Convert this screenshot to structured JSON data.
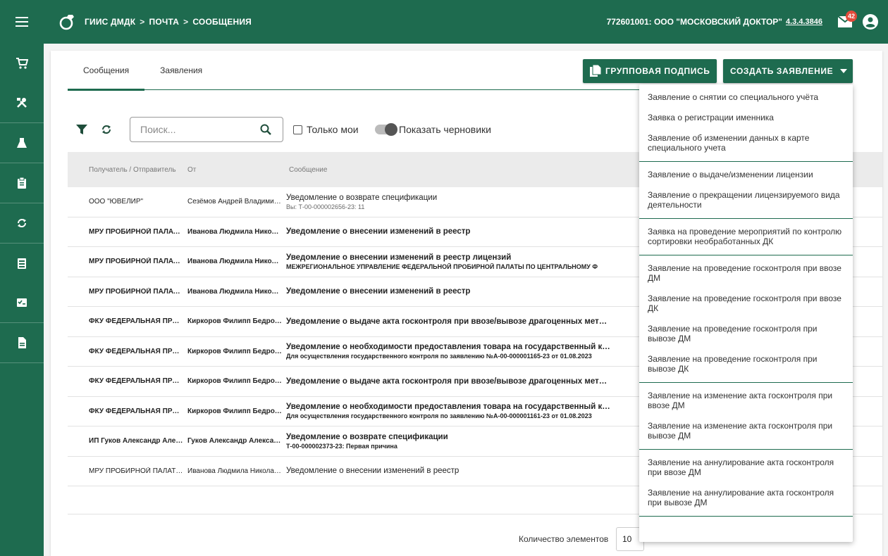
{
  "topbar": {
    "breadcrumb": [
      "ГИИС ДМДК",
      "ПОЧТА",
      "СООБЩЕНИЯ"
    ],
    "org": "772601001: ООО \"МОСКОВСКИЙ ДОКТОР\"",
    "version": "4.3.4.3846",
    "mail_count": "42"
  },
  "tabs": [
    {
      "label": "Сообщения"
    },
    {
      "label": "Заявления"
    }
  ],
  "buttons": {
    "group_sign": "ГРУППОВАЯ ПОДПИСЬ",
    "create": "СОЗДАТЬ ЗАЯВЛЕНИЕ"
  },
  "filters": {
    "search_placeholder": "Поиск...",
    "only_mine": "Только мои",
    "show_drafts": "Показать черновики"
  },
  "table": {
    "headers": [
      "Получатель / Отправитель",
      "От",
      "Сообщение"
    ],
    "rows": [
      {
        "recipient": "ООО \"ЮВЕЛИР\"",
        "from": "Сезёмов Андрей Владимирович",
        "subject": "Уведомление о возврате спецификации",
        "detail": "Вы: Т-00-000002656-23: 11",
        "bold": false
      },
      {
        "recipient": "МРУ ПРОБИРНОЙ ПАЛАТЫ ПО ЦФО",
        "from": "Иванова Людмила Николаевна",
        "subject": "Уведомление о внесении изменений в реестр",
        "detail": "",
        "bold": true
      },
      {
        "recipient": "МРУ ПРОБИРНОЙ ПАЛАТЫ ПО ЦФО",
        "from": "Иванова Людмила Николаевна",
        "subject": "Уведомление о внесении изменений в реестр лицензий",
        "detail": "МЕЖРЕГИОНАЛЬНОЕ УПРАВЛЕНИЕ ФЕДЕРАЛЬНОЙ ПРОБИРНОЙ ПАЛАТЫ ПО ЦЕНТРАЛЬНОМУ Ф",
        "bold": true
      },
      {
        "recipient": "МРУ ПРОБИРНОЙ ПАЛАТЫ ПО ЦФО",
        "from": "Иванова Людмила Николаевна",
        "subject": "Уведомление о внесении изменений в реестр",
        "detail": "",
        "bold": true
      },
      {
        "recipient": "ФКУ ФЕДЕРАЛЬНАЯ ПРОБИРНАЯ ПАЛАТА",
        "from": "Киркоров Филипп Бедросович",
        "subject": "Уведомление о выдаче акта госконтроля при ввозе/вывозе драгоценных мет…",
        "detail": "",
        "bold": true
      },
      {
        "recipient": "ФКУ ФЕДЕРАЛЬНАЯ ПРОБИРНАЯ ПАЛАТА",
        "from": "Киркоров Филипп Бедросович",
        "subject": "Уведомление о необходимости предоставления товара на государственный к…",
        "detail": "Для осуществления государственного контроля по заявлению №А-00-000001165-23 от 01.08.2023",
        "bold": true
      },
      {
        "recipient": "ФКУ ФЕДЕРАЛЬНАЯ ПРОБИРНАЯ ПАЛАТА",
        "from": "Киркоров Филипп Бедросович",
        "subject": "Уведомление о выдаче акта госконтроля при ввозе/вывозе драгоценных мет…",
        "detail": "",
        "bold": true
      },
      {
        "recipient": "ФКУ ФЕДЕРАЛЬНАЯ ПРОБИРНАЯ ПАЛАТА",
        "from": "Киркоров Филипп Бедросович",
        "subject": "Уведомление о необходимости предоставления товара на государственный к…",
        "detail": "Для осуществления государственного контроля по заявлению №А-00-000001161-23 от 01.08.2023",
        "bold": true
      },
      {
        "recipient": "ИП Гуков Александр Александрович",
        "from": "Гуков Александр Александрович",
        "subject": "Уведомление о возврате спецификации",
        "detail": "Т-00-000002373-23: Первая причина",
        "bold": true
      },
      {
        "recipient": "МРУ ПРОБИРНОЙ ПАЛАТЫ ПО ЦФО",
        "from": "Иванова Людмила Николаевна",
        "subject": "Уведомление о внесении изменений в реестр",
        "detail": "",
        "bold": false
      }
    ]
  },
  "footer": {
    "count_label": "Количество элементов",
    "count_value": "10"
  },
  "dropdown": [
    [
      "Заявление о снятии со специального учёта",
      "Заявка о регистрации именника",
      "Заявление об изменении данных в карте специального учета"
    ],
    [
      "Заявление о выдаче/изменении лицензии",
      "Заявление о прекращении лицензируемого вида деятельности"
    ],
    [
      "Заявка на проведение мероприятий по контролю сортировки необработанных ДК"
    ],
    [
      "Заявление на проведение госконтроля при ввозе ДМ",
      "Заявление на проведение госконтроля при ввозе ДК",
      "Заявление на проведение госконтроля при вывозе ДМ",
      "Заявление на проведение госконтроля при вывозе ДК"
    ],
    [
      "Заявление на изменение акта госконтроля при ввозе ДМ",
      "Заявление на изменение акта госконтроля при вывозе ДМ"
    ],
    [
      "Заявление на аннулирование акта госконтроля при ввозе ДМ",
      "Заявление на аннулирование акта госконтроля при вывозе ДМ"
    ]
  ]
}
